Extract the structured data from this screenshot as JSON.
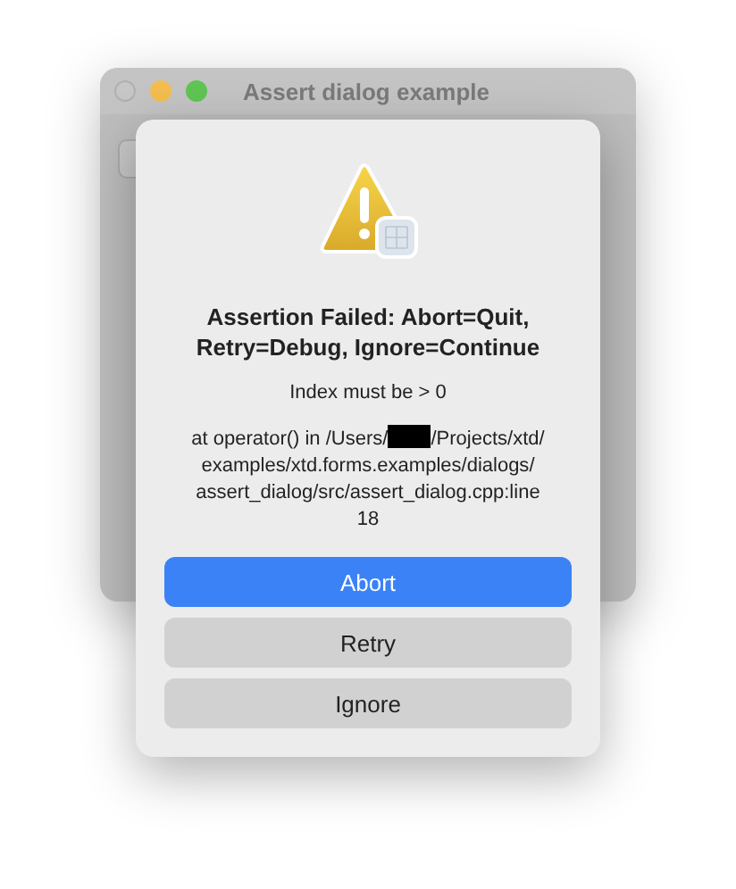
{
  "window": {
    "title": "Assert dialog example"
  },
  "dialog": {
    "title": "Assertion Failed: Abort=Quit, Retry=Debug, Ignore=Continue",
    "message": "Index must be > 0",
    "location": {
      "before": "at operator() in /Users/",
      "redacted": true,
      "after": "/Projects/xtd/examples/xtd.forms.examples/dialogs/assert_dialog/src/assert_dialog.cpp:line 18"
    },
    "buttons": [
      {
        "label": "Abort",
        "default": true
      },
      {
        "label": "Retry",
        "default": false
      },
      {
        "label": "Ignore",
        "default": false
      }
    ]
  }
}
